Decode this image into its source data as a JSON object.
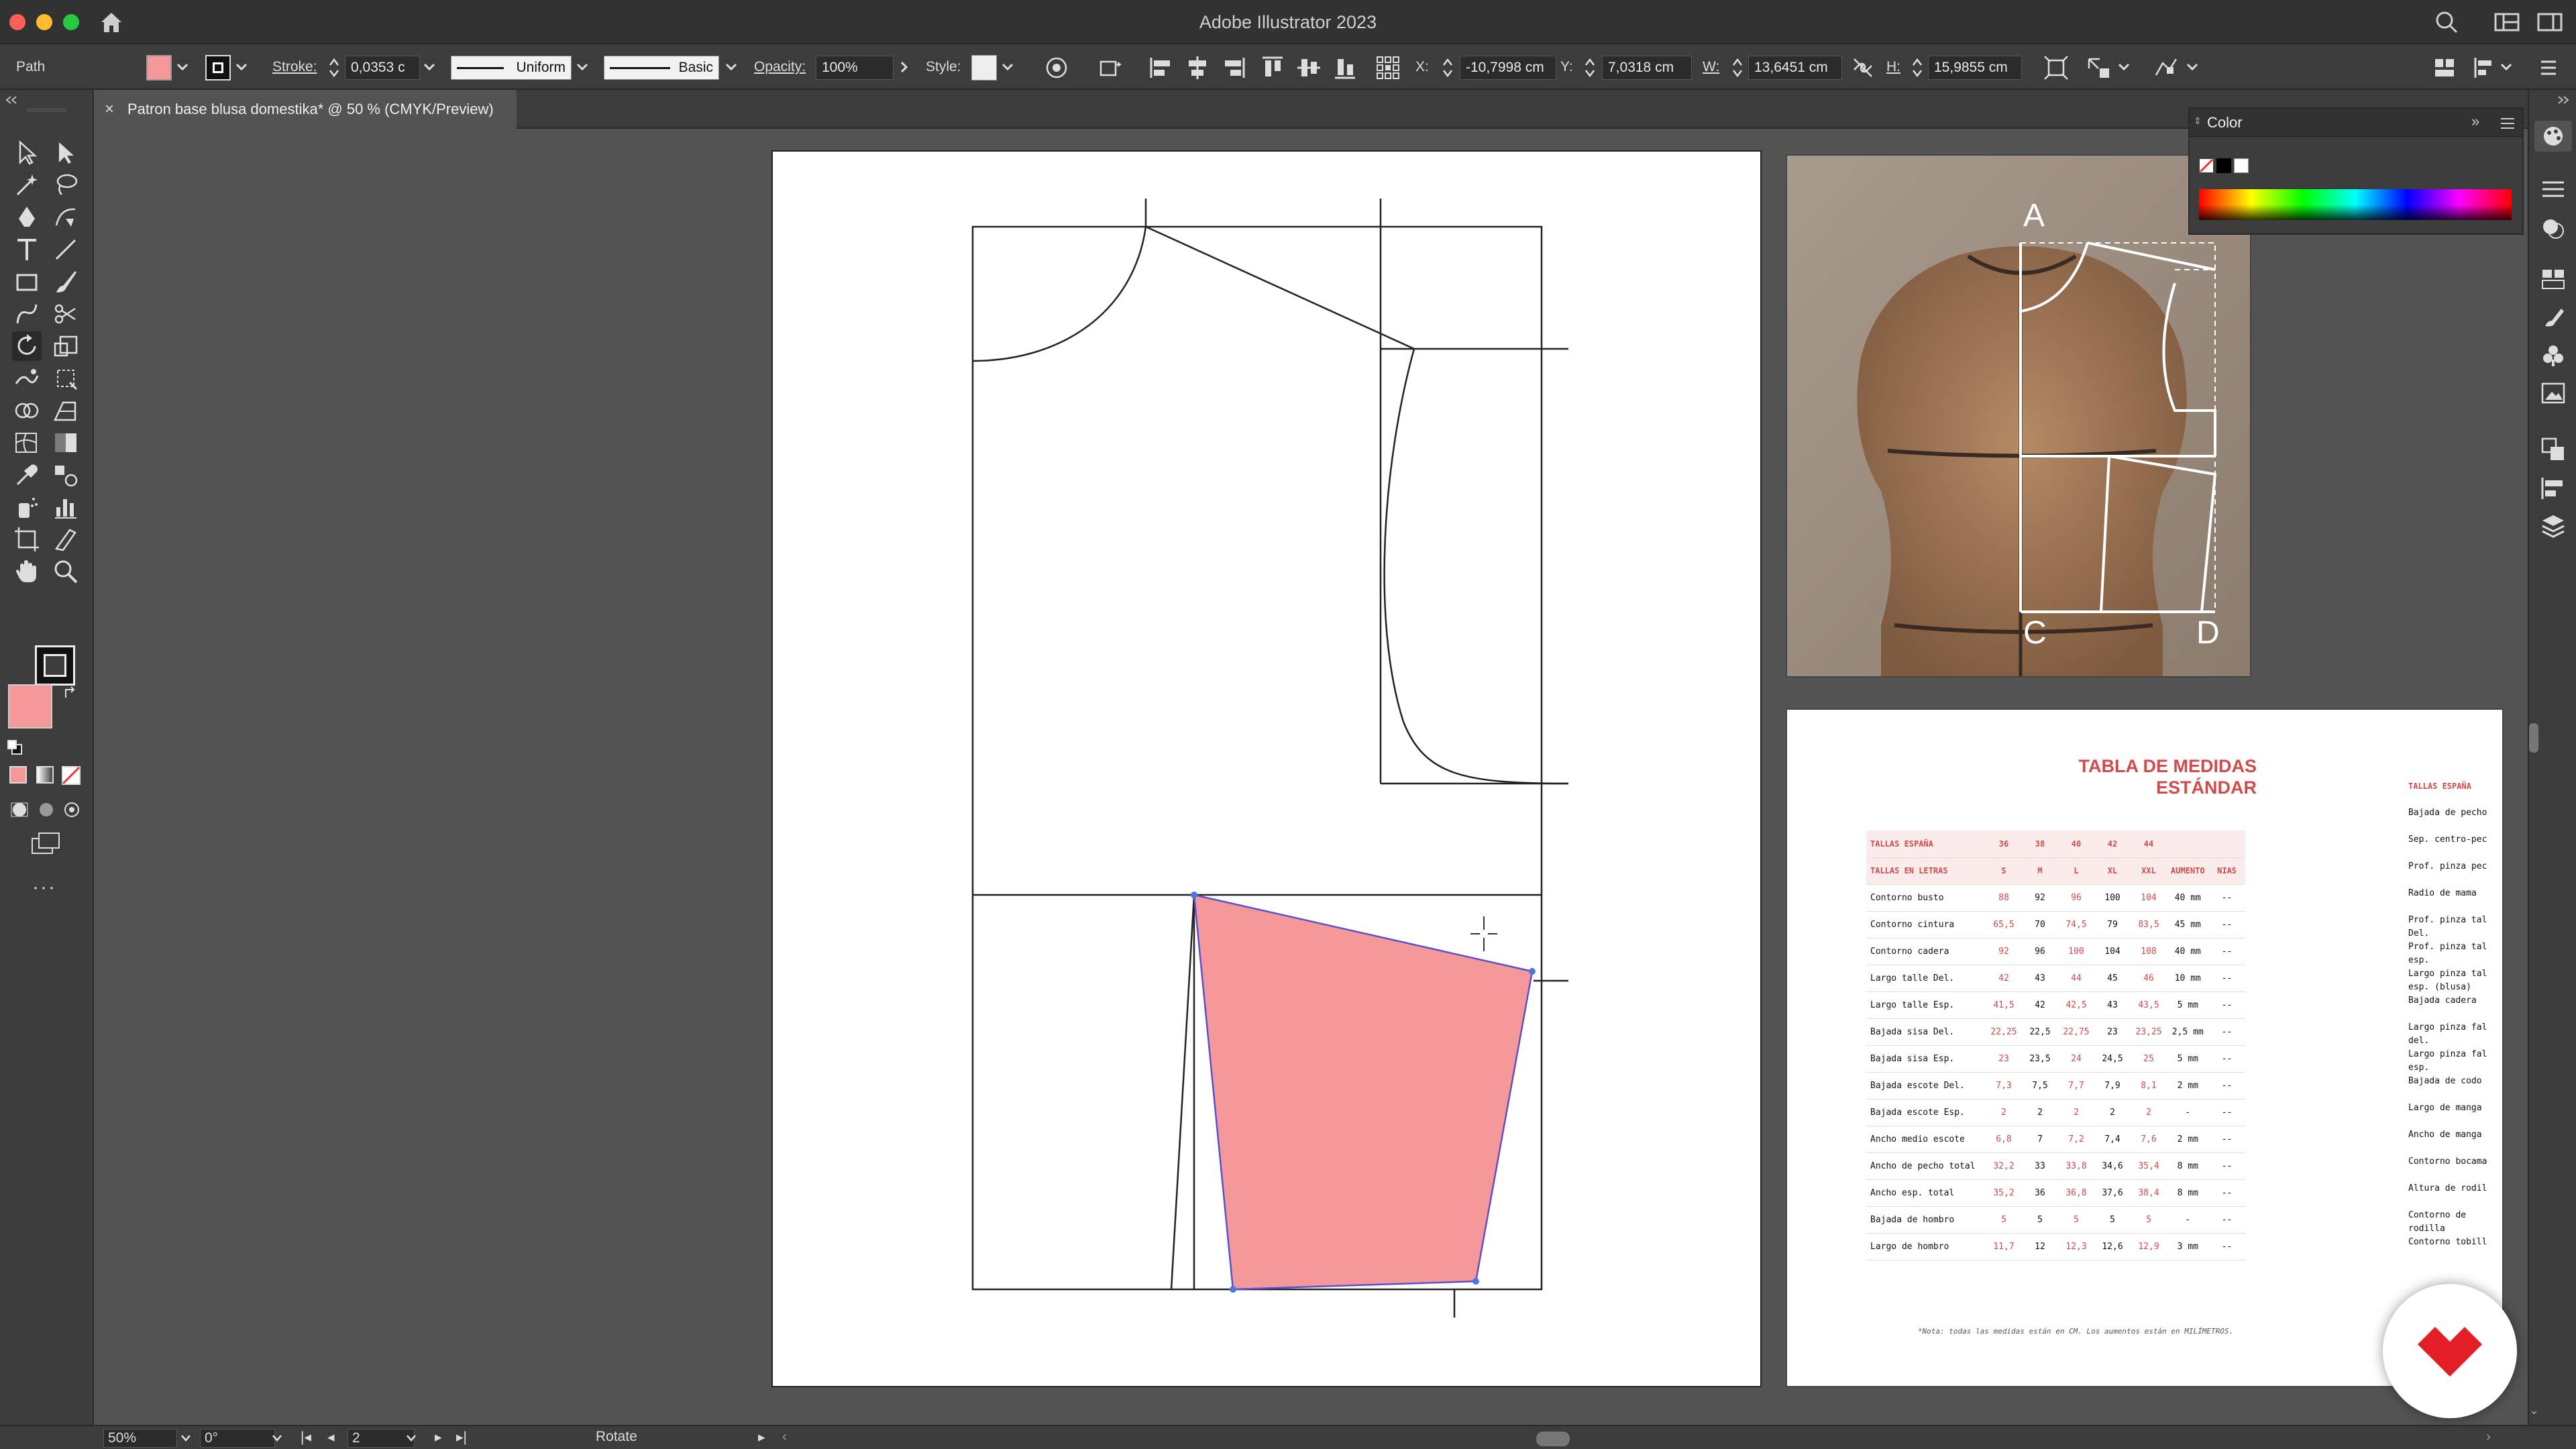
{
  "window": {
    "title": "Adobe Illustrator 2023"
  },
  "control_bar": {
    "selection_type": "Path",
    "fill_color": "#f4989a",
    "stroke_label": "Stroke:",
    "stroke_value": "0,0353 c",
    "stroke_profile": "Uniform",
    "brush": "Basic",
    "opacity_label": "Opacity:",
    "opacity_value": "100%",
    "style_label": "Style:",
    "x_label": "X:",
    "x_value": "-10,7998 cm",
    "y_label": "Y:",
    "y_value": "7,0318 cm",
    "w_label": "W:",
    "w_value": "13,6451 cm",
    "h_label": "H:",
    "h_value": "15,9855 cm"
  },
  "document_tab": {
    "title": "Patron base blusa domestika* @ 50 % (CMYK/Preview)"
  },
  "color_panel": {
    "title": "Color"
  },
  "tools": [
    "selection",
    "direct-selection",
    "magic-wand",
    "lasso",
    "pen",
    "curvature",
    "type",
    "line",
    "rectangle",
    "paintbrush",
    "shaper",
    "scissors",
    "rotate",
    "scale",
    "warp",
    "free-transform",
    "shape-builder",
    "perspective",
    "mesh",
    "gradient",
    "eyedropper",
    "blend",
    "symbol-sprayer",
    "column-graph",
    "artboard",
    "slice",
    "hand",
    "zoom"
  ],
  "reference_image": {
    "labels": [
      "A",
      "C",
      "D"
    ]
  },
  "size_table": {
    "title_line1": "TABLA DE MEDIDAS",
    "title_line2": "ESTÁNDAR",
    "header_row1": [
      "TALLAS ESPAÑA",
      "36",
      "38",
      "40",
      "42",
      "44",
      "",
      ""
    ],
    "header_row2": [
      "TALLAS EN LETRAS",
      "S",
      "M",
      "L",
      "XL",
      "XXL",
      "AUMENTO",
      "NIAS"
    ],
    "rows": [
      [
        "Contorno busto",
        "88",
        "92",
        "96",
        "100",
        "104",
        "40 mm",
        "--"
      ],
      [
        "Contorno cintura",
        "65,5",
        "70",
        "74,5",
        "79",
        "83,5",
        "45 mm",
        "--"
      ],
      [
        "Contorno cadera",
        "92",
        "96",
        "100",
        "104",
        "108",
        "40 mm",
        "--"
      ],
      [
        "Largo talle Del.",
        "42",
        "43",
        "44",
        "45",
        "46",
        "10 mm",
        "--"
      ],
      [
        "Largo talle Esp.",
        "41,5",
        "42",
        "42,5",
        "43",
        "43,5",
        "5 mm",
        "--"
      ],
      [
        "Bajada sisa Del.",
        "22,25",
        "22,5",
        "22,75",
        "23",
        "23,25",
        "2,5 mm",
        "--"
      ],
      [
        "Bajada sisa Esp.",
        "23",
        "23,5",
        "24",
        "24,5",
        "25",
        "5 mm",
        "--"
      ],
      [
        "Bajada escote Del.",
        "7,3",
        "7,5",
        "7,7",
        "7,9",
        "8,1",
        "2 mm",
        "--"
      ],
      [
        "Bajada escote Esp.",
        "2",
        "2",
        "2",
        "2",
        "2",
        "-",
        "--"
      ],
      [
        "Ancho medio escote",
        "6,8",
        "7",
        "7,2",
        "7,4",
        "7,6",
        "2 mm",
        "--"
      ],
      [
        "Ancho de pecho total",
        "32,2",
        "33",
        "33,8",
        "34,6",
        "35,4",
        "8 mm",
        "--"
      ],
      [
        "Ancho esp. total",
        "35,2",
        "36",
        "36,8",
        "37,6",
        "38,4",
        "8 mm",
        "--"
      ],
      [
        "Bajada de hombro",
        "5",
        "5",
        "5",
        "5",
        "5",
        "-",
        "--"
      ],
      [
        "Largo de hombro",
        "11,7",
        "12",
        "12,3",
        "12,6",
        "12,9",
        "3 mm",
        "--"
      ]
    ],
    "note": "*Nota: todas las medidas están en CM. Los aumentos están en MILÍMETROS.",
    "right_column": [
      "TALLAS ESPAÑA",
      "Bajada de pecho",
      "Sep. centro-pec",
      "Prof. pinza pec",
      "Radio de mama",
      "Prof. pinza tal Del.",
      "Prof. pinza tal esp.",
      "Largo pinza tal esp. (blusa)",
      "Bajada cadera",
      "Largo pinza fal del.",
      "Largo pinza fal esp.",
      "Bajada de codo",
      "Largo de manga",
      "Ancho de manga",
      "Contorno bocama",
      "Altura de rodil",
      "Contorno de rodilla",
      "Contorno tobill"
    ]
  },
  "status_bar": {
    "zoom": "50%",
    "rotation": "0°",
    "artboard_number": "2",
    "current_tool": "Rotate"
  }
}
